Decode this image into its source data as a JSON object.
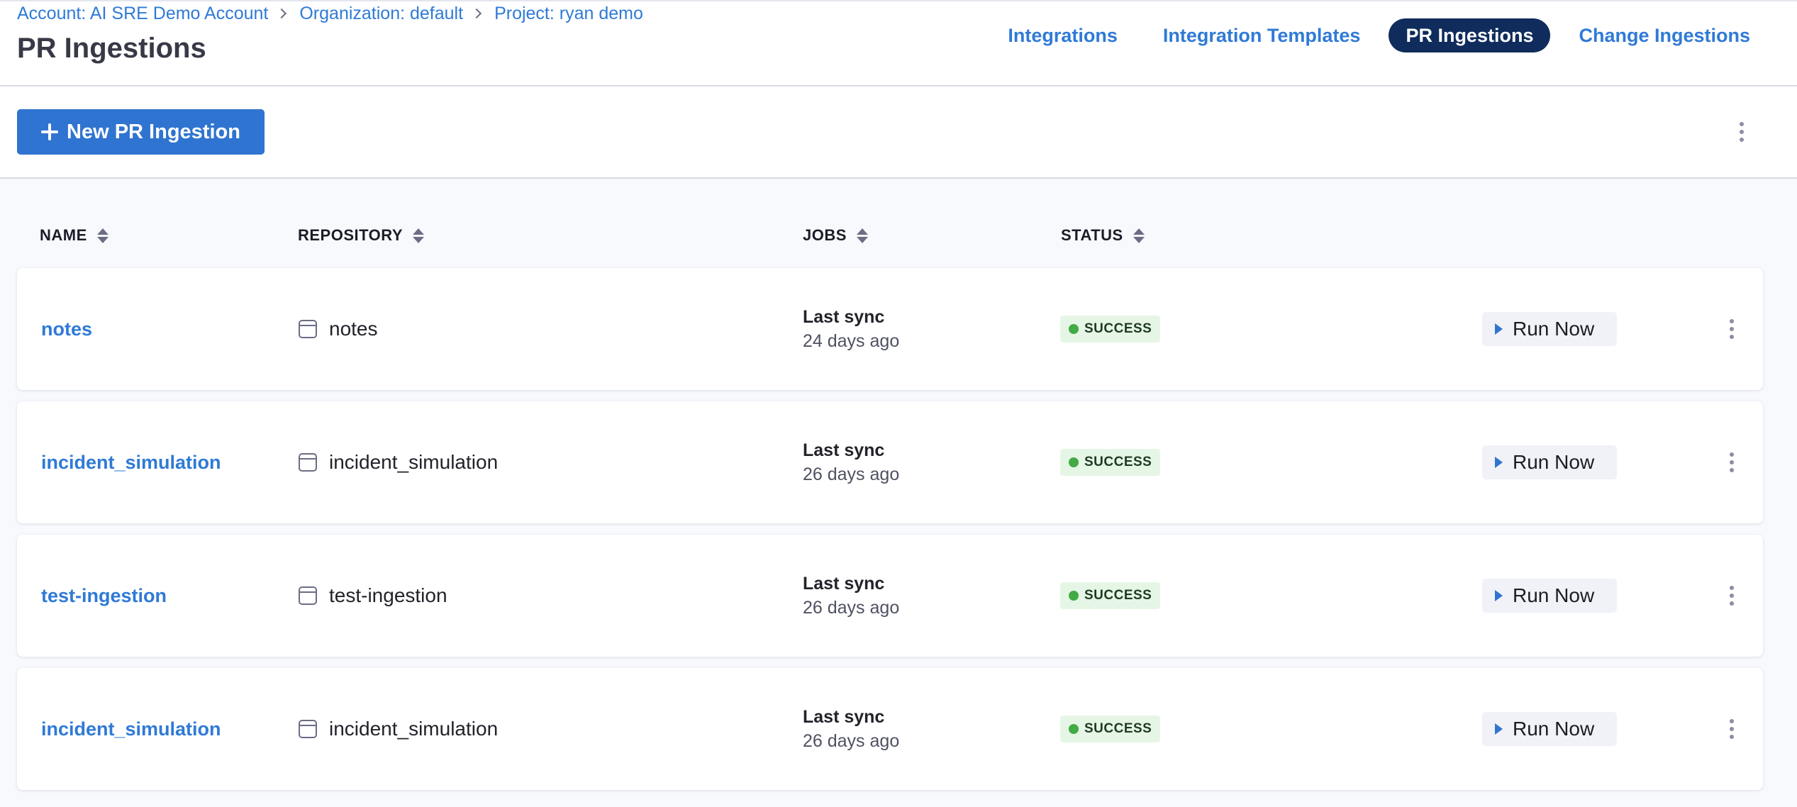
{
  "breadcrumb": {
    "account": "Account: AI SRE Demo Account",
    "organization": "Organization: default",
    "project": "Project: ryan demo"
  },
  "page_title": "PR Ingestions",
  "tabs": [
    {
      "label": "Integrations",
      "active": false
    },
    {
      "label": "Integration Templates",
      "active": false
    },
    {
      "label": "PR Ingestions",
      "active": true
    },
    {
      "label": "Change Ingestions",
      "active": false
    }
  ],
  "toolbar": {
    "new_button_label": "New PR Ingestion"
  },
  "table": {
    "columns": [
      "NAME",
      "REPOSITORY",
      "JOBS",
      "STATUS"
    ],
    "rows": [
      {
        "name": "notes",
        "repository": "notes",
        "jobs_label": "Last sync",
        "jobs_time": "24 days ago",
        "status": "SUCCESS",
        "action": "Run Now"
      },
      {
        "name": "incident_simulation",
        "repository": "incident_simulation",
        "jobs_label": "Last sync",
        "jobs_time": "26 days ago",
        "status": "SUCCESS",
        "action": "Run Now"
      },
      {
        "name": "test-ingestion",
        "repository": "test-ingestion",
        "jobs_label": "Last sync",
        "jobs_time": "26 days ago",
        "status": "SUCCESS",
        "action": "Run Now"
      },
      {
        "name": "incident_simulation",
        "repository": "incident_simulation",
        "jobs_label": "Last sync",
        "jobs_time": "26 days ago",
        "status": "SUCCESS",
        "action": "Run Now"
      }
    ]
  },
  "icons": {
    "plus": "plus-icon",
    "sort": "sort-icon",
    "repository": "repository-icon",
    "play": "play-icon",
    "more": "kebab-menu-icon",
    "breadcrumb_separator": "chevron-right-icon"
  },
  "colors": {
    "accent": "#2f74d0",
    "link": "#2f7ad6",
    "active_tab": "#0f2c5c",
    "success_bg": "#e6f6e6",
    "success_dot": "#42ab45",
    "content_bg": "#f7f9fd"
  }
}
